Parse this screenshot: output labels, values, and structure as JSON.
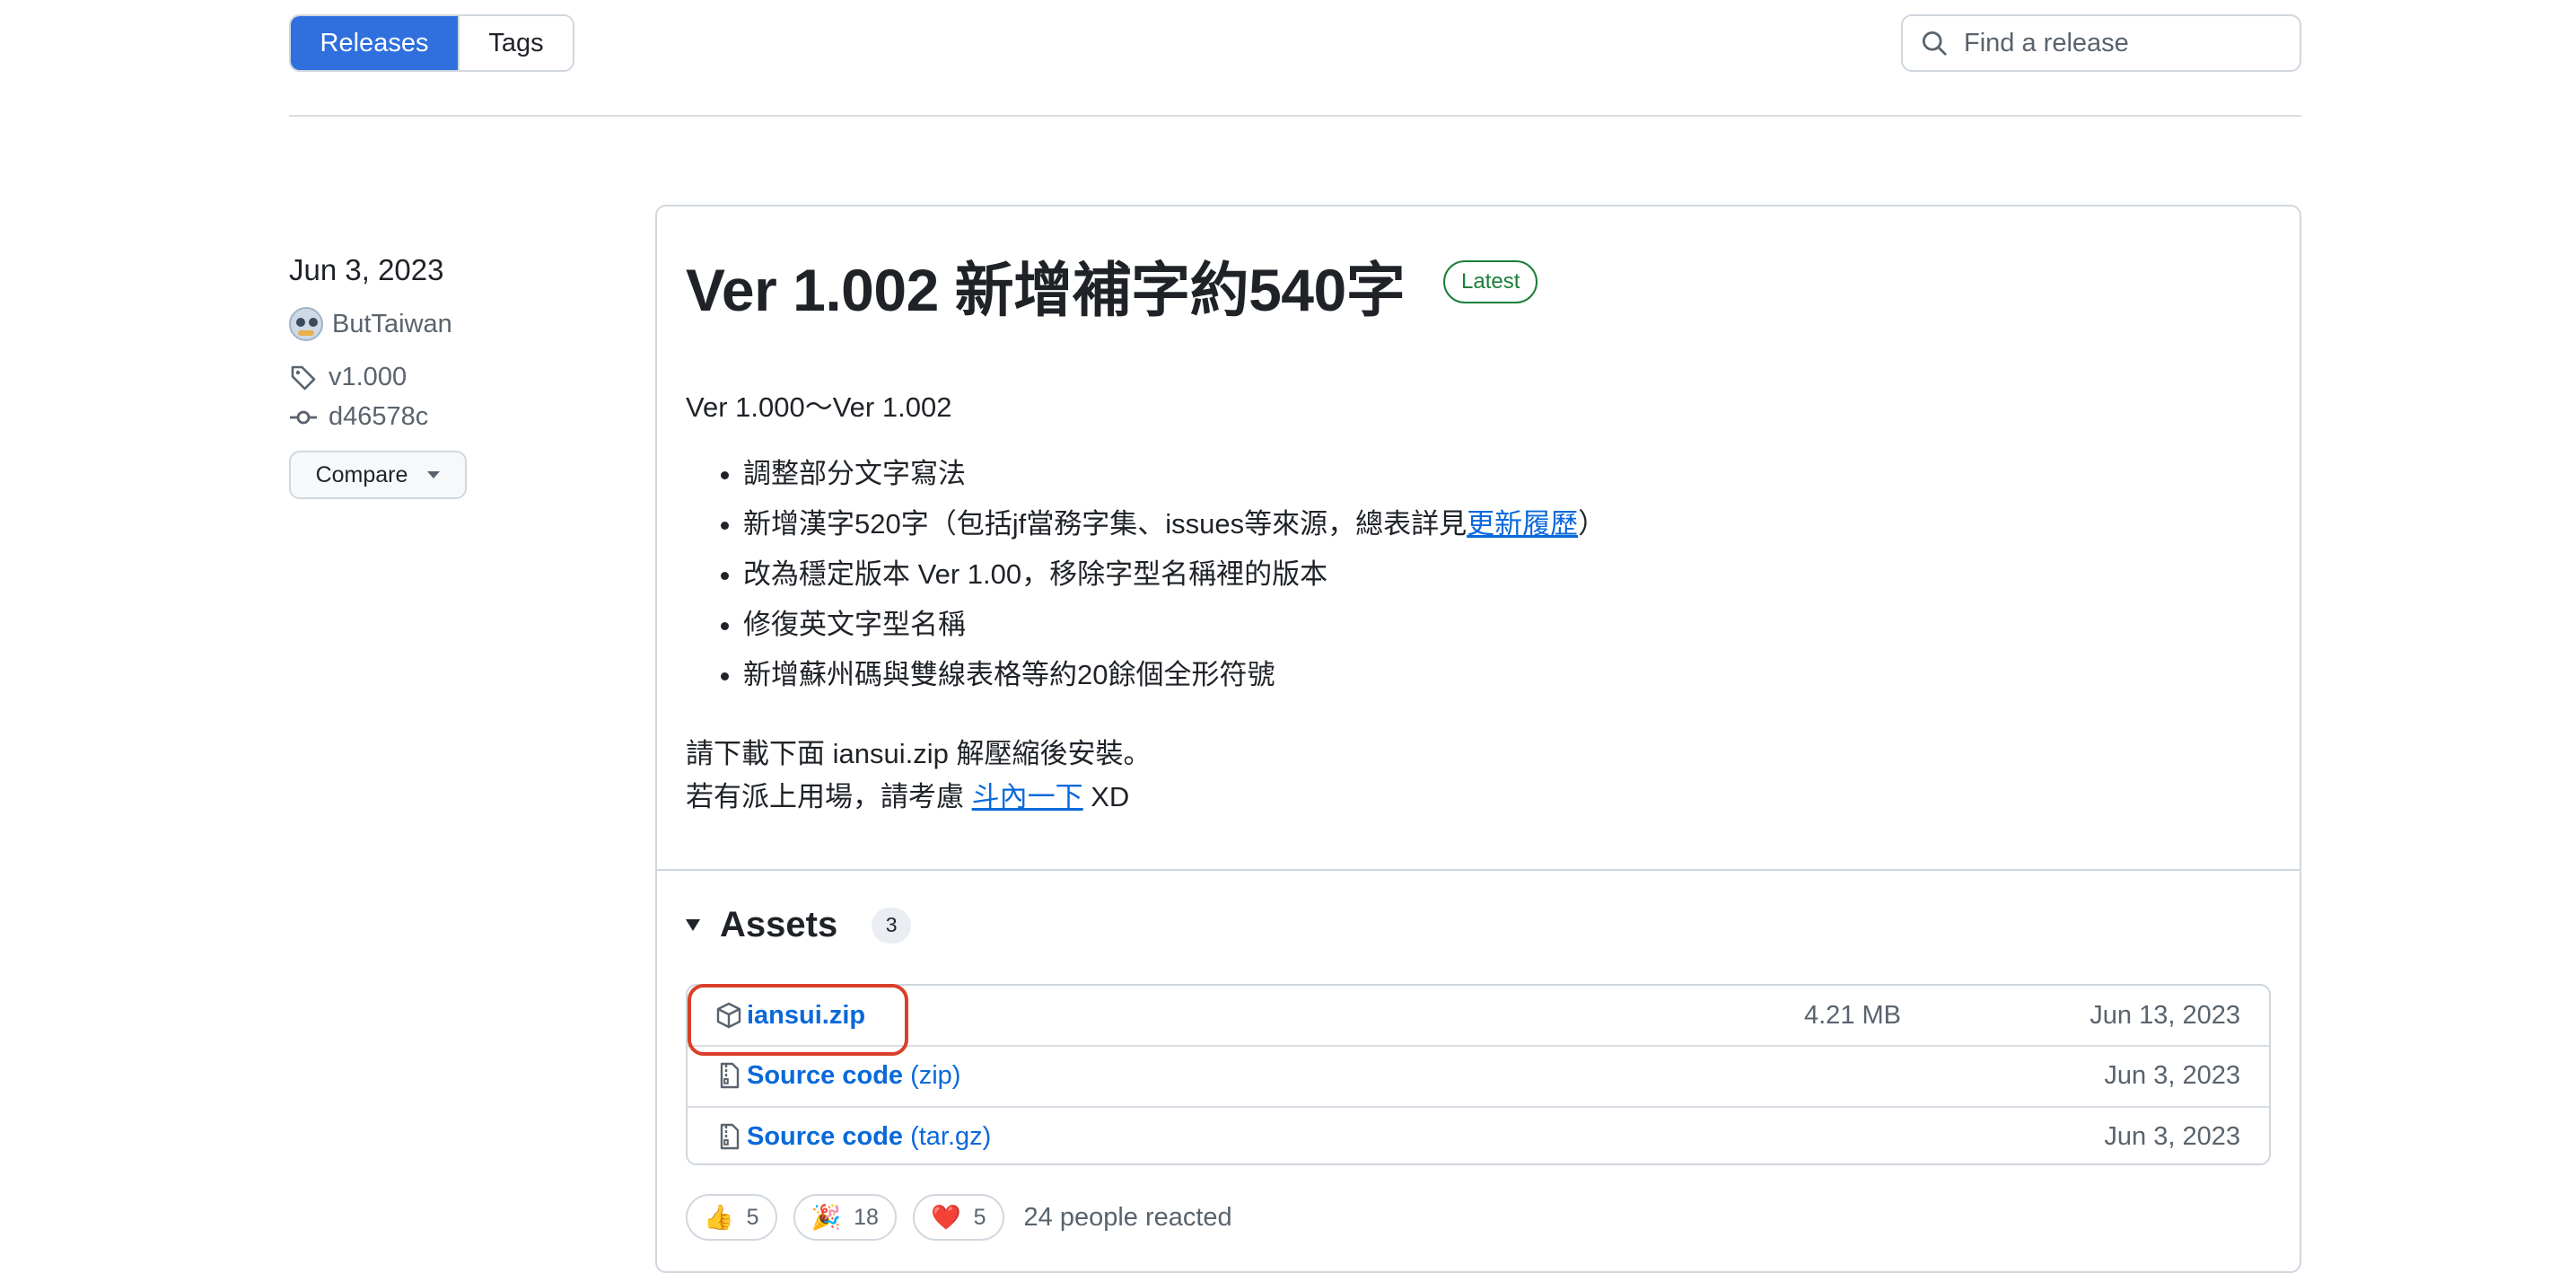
{
  "nav": {
    "releases_label": "Releases",
    "tags_label": "Tags",
    "search_placeholder": "Find a release"
  },
  "sidebar": {
    "date": "Jun 3, 2023",
    "author": "ButTaiwan",
    "tag": "v1.000",
    "commit": "d46578c",
    "compare_label": "Compare"
  },
  "release": {
    "title": "Ver 1.002 新增補字約540字",
    "badge": "Latest",
    "version_range": "Ver 1.000～Ver 1.002",
    "bullets": [
      "調整部分文字寫法",
      "新增漢字520字（包括jf當務字集、issues等來源，總表詳見",
      "改為穩定版本 Ver 1.00，移除字型名稱裡的版本",
      "修復英文字型名稱",
      "新增蘇州碼與雙線表格等約20餘個全形符號"
    ],
    "bullet2_link": "更新履歷",
    "bullet2_suffix": "）",
    "download_note": "請下載下面 iansui.zip 解壓縮後安裝。",
    "donate_prefix": "若有派上用場，請考慮 ",
    "donate_link": "斗內一下",
    "donate_suffix": " XD"
  },
  "assets": {
    "title": "Assets",
    "count": "3",
    "items": [
      {
        "name": "iansui.zip",
        "ext": "",
        "size": "4.21 MB",
        "date": "Jun 13, 2023",
        "icon": "package-icon"
      },
      {
        "name": "Source code",
        "ext": "(zip)",
        "size": "",
        "date": "Jun 3, 2023",
        "icon": "file-zip-icon"
      },
      {
        "name": "Source code",
        "ext": "(tar.gz)",
        "size": "",
        "date": "Jun 3, 2023",
        "icon": "file-zip-icon"
      }
    ]
  },
  "reactions": {
    "items": [
      {
        "emoji": "👍",
        "count": "5"
      },
      {
        "emoji": "🎉",
        "count": "18"
      },
      {
        "emoji": "❤️",
        "count": "5"
      }
    ],
    "summary": "24 people reacted"
  },
  "colors": {
    "primary": "#2f6fde",
    "link": "#0969da",
    "latest_green": "#1a7f37",
    "highlight_red": "#d93f2a"
  }
}
